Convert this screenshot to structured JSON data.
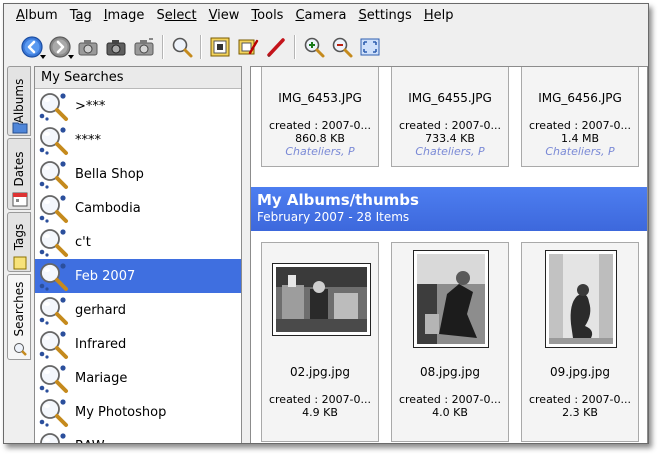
{
  "menubar": {
    "items": [
      {
        "first": "A",
        "rest": "lbum"
      },
      {
        "first": "T",
        "rest": "ag"
      },
      {
        "first": "I",
        "rest": "mage"
      },
      {
        "first": "S",
        "rest": "elect"
      },
      {
        "first": "V",
        "rest": "iew"
      },
      {
        "first": "T",
        "rest": "ools"
      },
      {
        "first": "C",
        "rest": "amera"
      },
      {
        "first": "S",
        "rest": "ettings"
      },
      {
        "first": "H",
        "rest": "elp"
      }
    ]
  },
  "toolbar": {
    "buttons": [
      "back-icon",
      "forward-icon",
      "camera-gray-icon",
      "camera-dark-icon",
      "camera-gray-2-icon",
      "magnifier-icon",
      "film-frame-icon",
      "edit-image-icon",
      "red-pencil-icon",
      "zoom-in-icon",
      "zoom-out-icon",
      "fullscreen-icon"
    ]
  },
  "sidebar_tabs": {
    "albums": "Albums",
    "dates": "Dates",
    "tags": "Tags",
    "searches": "Searches"
  },
  "searches": {
    "header": "My Searches",
    "items": [
      ">***",
      "****",
      "Bella Shop",
      "Cambodia",
      "c't",
      "Feb 2007",
      "gerhard",
      "Infrared",
      "Mariage",
      "My Photoshop",
      "RAW"
    ],
    "selected_index": 5
  },
  "top_row": [
    {
      "name": "IMG_6453.JPG",
      "created": "created : 2007-0...",
      "size": "860.8 KB",
      "owner": "Chateliers, P"
    },
    {
      "name": "IMG_6455.JPG",
      "created": "created : 2007-0...",
      "size": "733.4 KB",
      "owner": "Chateliers, P"
    },
    {
      "name": "IMG_6456.JPG",
      "created": "created : 2007-0...",
      "size": "1.4 MB",
      "owner": "Chateliers, P"
    }
  ],
  "album_group": {
    "title": "My Albums/thumbs",
    "subtitle": "February 2007 - 28 Items"
  },
  "bottom_row": [
    {
      "name": "02.jpg.jpg",
      "created": "created : 2007-0...",
      "size": "4.9 KB"
    },
    {
      "name": "08.jpg.jpg",
      "created": "created : 2007-0...",
      "size": "4.0 KB"
    },
    {
      "name": "09.jpg.jpg",
      "created": "created : 2007-0...",
      "size": "2.3 KB"
    }
  ],
  "colors": {
    "selection": "#3f6fe0",
    "album_header": "#4574e8",
    "owner_text": "#7b8ad6"
  }
}
